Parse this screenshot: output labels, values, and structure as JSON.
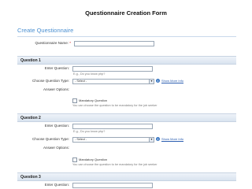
{
  "document_title": "Questionnaire Creation Form",
  "app_title": "Create Questionnaire",
  "name_field": {
    "label": "Questionnaire Name:",
    "required_marker": "*",
    "value": ""
  },
  "sections": [
    {
      "heading": "Question 1",
      "enter_question_label": "Enter Question:",
      "question_value": "",
      "example_hint": "E.g., Do you know php?",
      "type_label": "Choose Question Type:",
      "type_selected": "- Select -",
      "info_link": "Show More Info",
      "answer_options_label": "Answer Options:",
      "mandatory_label": "Mandatory Question",
      "mandatory_checked": false,
      "mandatory_hint": "You can choose the question to be mandatory for the job seeker"
    },
    {
      "heading": "Question 2",
      "enter_question_label": "Enter Question:",
      "question_value": "",
      "example_hint": "E.g., Do you know php?",
      "type_label": "Choose Question Type:",
      "type_selected": "- Select -",
      "info_link": "Show More Info",
      "answer_options_label": "Answer Options:",
      "mandatory_label": "Mandatory Question",
      "mandatory_checked": false,
      "mandatory_hint": "You can choose the question to be mandatory for the job seeker"
    },
    {
      "heading": "Question 3",
      "enter_question_label": "Enter Question:",
      "question_value": ""
    }
  ],
  "icons": {
    "dropdown": "chevron-down-icon",
    "info": "info-icon"
  },
  "colors": {
    "accent": "#4a8fd1",
    "link": "#2a5db0",
    "section_band": "#dfe7f1"
  }
}
